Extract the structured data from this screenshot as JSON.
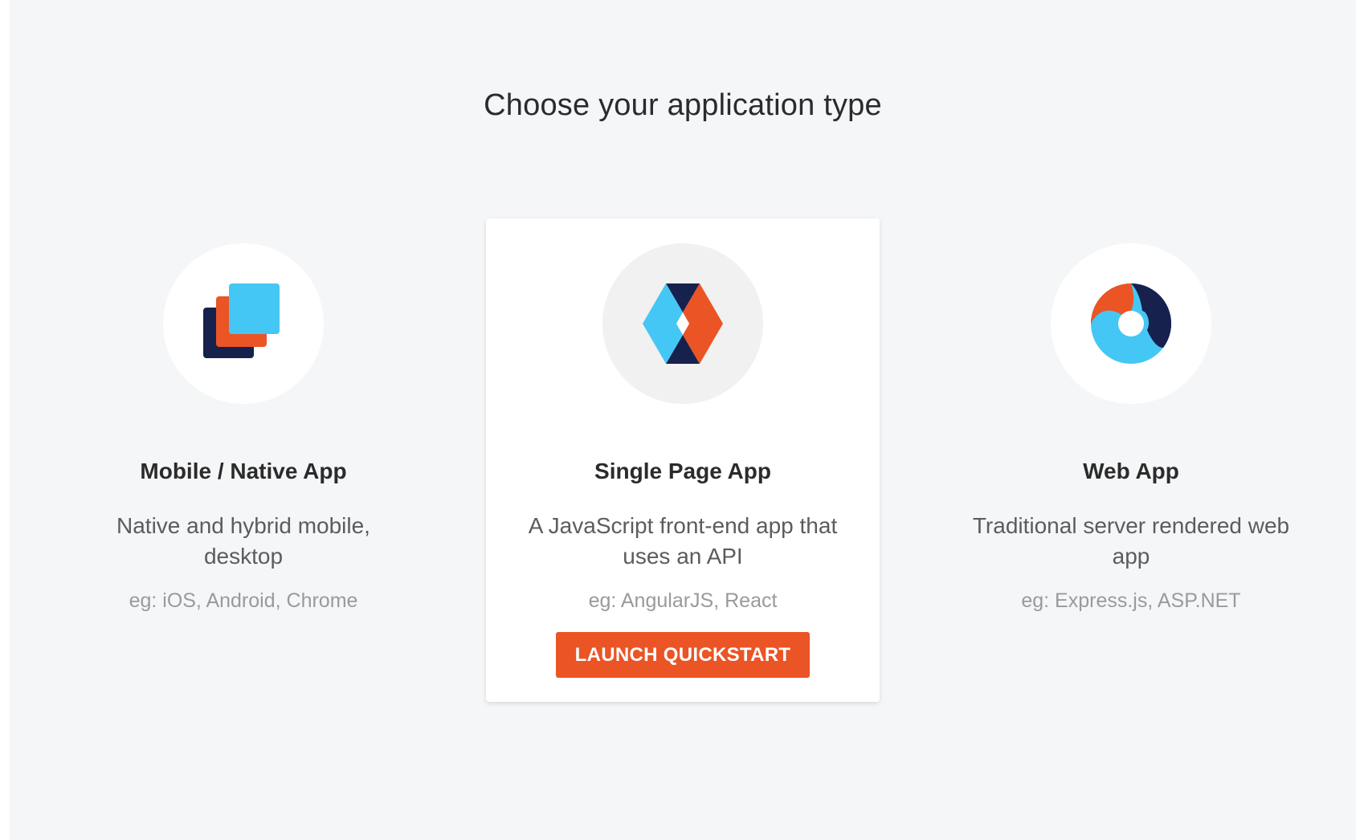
{
  "page": {
    "title": "Choose your application type"
  },
  "colors": {
    "orange": "#eb5424",
    "navy": "#16214d",
    "sky": "#44c7f4",
    "background": "#f5f6f8"
  },
  "cards": [
    {
      "title": "Mobile / Native App",
      "description": "Native and hybrid mobile, desktop",
      "examples": "eg: iOS, Android, Chrome",
      "icon": "stacked-squares-icon",
      "selected": false
    },
    {
      "title": "Single Page App",
      "description": "A JavaScript front-end app that uses an API",
      "examples": "eg: AngularJS, React",
      "icon": "diamond-icon",
      "selected": true,
      "button_label": "LAUNCH QUICKSTART"
    },
    {
      "title": "Web App",
      "description": "Traditional server rendered web app",
      "examples": "eg: Express.js, ASP.NET",
      "icon": "swirl-ring-icon",
      "selected": false
    }
  ]
}
